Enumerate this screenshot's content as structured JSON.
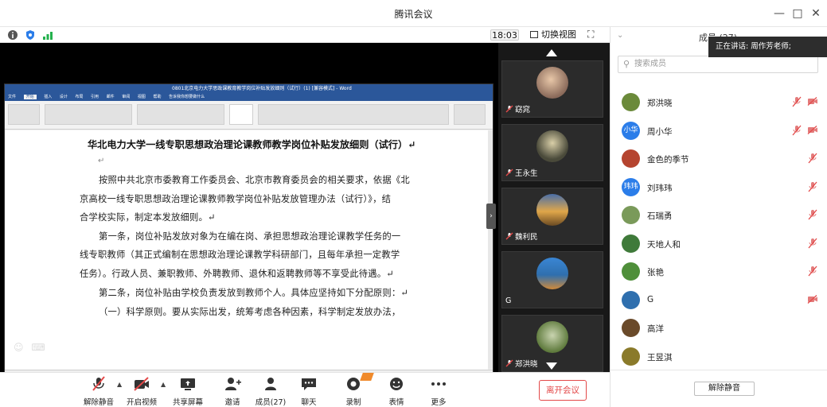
{
  "window": {
    "title": "腾讯会议"
  },
  "status": {
    "time": "18:03",
    "switch_view": "切换视图"
  },
  "document": {
    "window_title": "0801北京电力大学思政课教育教学岗位补贴发放细则（试行）(1) [兼容模式] - Word",
    "menu": [
      "文件",
      "开始",
      "插入",
      "设计",
      "布局",
      "引用",
      "邮件",
      "审阅",
      "视图",
      "帮助",
      "告诉我你想要做什么"
    ],
    "title": "华北电力大学一线专职思想政治理论课教师教学岗位补贴发放细则（试行）↵",
    "paragraph_mark": "↵",
    "lines": [
      "按照中共北京市委教育工作委员会、北京市教育委员会的相关要求，依据《北",
      "京高校一线专职思想政治理论课教师教学岗位补贴发放管理办法（试行）》，结",
      "合学校实际，制定本发放细则。↵",
      "第一条，岗位补贴发放对象为在编在岗、承担思想政治理论课教学任务的一",
      "线专职教师（其正式编制在思想政治理论课教学科研部门，且每年承担一定教学",
      "任务）。行政人员、兼职教师、外聘教师、退休和返聘教师等不享受此待遇。↵",
      "第二条，岗位补贴由学校负责发放到教师个人。具体应坚持如下分配原则：↵",
      "（一）科学原则。要从实际出发，统筹考虑各种因素，科学制定发放办法，"
    ]
  },
  "tiles": [
    {
      "name": "窈窕",
      "avatar_color": "#8a6a5a"
    },
    {
      "name": "王永生",
      "avatar_color": "#4a4a3a"
    },
    {
      "name": "魏利民",
      "avatar_color": "#b7863e"
    },
    {
      "name": "G",
      "avatar_color": "#2f6fae"
    },
    {
      "name": "郑洪晓",
      "avatar_color": "#5e7a3c"
    }
  ],
  "toolbar": {
    "mute": "解除静音",
    "video": "开启视频",
    "share": "共享屏幕",
    "invite": "邀请",
    "members": "成员(27)",
    "chat": "聊天",
    "record": "录制",
    "reaction": "表情",
    "more": "更多",
    "leave": "离开会议"
  },
  "panel": {
    "header": "成员 (27)",
    "speaking": "正在讲话: 周作芳老师;",
    "search_placeholder": "搜索成员",
    "unmute_all": "解除静音",
    "members": [
      {
        "name": "郑洪晓",
        "avatar_text": "",
        "avatar_color": "#6b8a3a",
        "mic_muted": true,
        "cam_muted": true
      },
      {
        "name": "周小华",
        "avatar_text": "小华",
        "avatar_color": "#2b7de9",
        "mic_muted": true,
        "cam_muted": true
      },
      {
        "name": "金色的季节",
        "avatar_text": "",
        "avatar_color": "#b5442f",
        "mic_muted": true,
        "cam_muted": false
      },
      {
        "name": "刘玮玮",
        "avatar_text": "玮玮",
        "avatar_color": "#2b7de9",
        "mic_muted": true,
        "cam_muted": false
      },
      {
        "name": "石瑞勇",
        "avatar_text": "",
        "avatar_color": "#7a9a5a",
        "mic_muted": true,
        "cam_muted": false
      },
      {
        "name": "天地人和",
        "avatar_text": "",
        "avatar_color": "#3f7a3a",
        "mic_muted": true,
        "cam_muted": false
      },
      {
        "name": "张艳",
        "avatar_text": "",
        "avatar_color": "#4f8f3a",
        "mic_muted": true,
        "cam_muted": false
      },
      {
        "name": "G",
        "avatar_text": "",
        "avatar_color": "#2f6fae",
        "mic_muted": false,
        "cam_muted": true
      },
      {
        "name": "高洋",
        "avatar_text": "",
        "avatar_color": "#6a4a2a",
        "mic_muted": false,
        "cam_muted": false
      },
      {
        "name": "王昱淇",
        "avatar_text": "",
        "avatar_color": "#8a7a2a",
        "mic_muted": false,
        "cam_muted": false
      }
    ]
  },
  "colors": {
    "brand": "#2b579a",
    "leave_red": "#e34848",
    "accent_blue": "#2b7de9"
  }
}
